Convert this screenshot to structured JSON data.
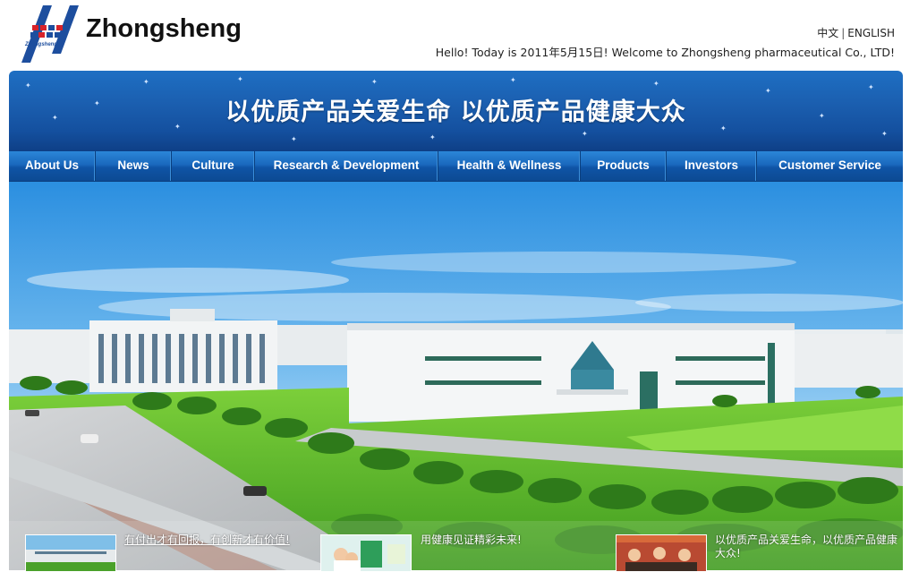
{
  "header": {
    "brand": "Zhongsheng",
    "logo_caption": "Zhongsheng",
    "lang_cn": "中文",
    "lang_sep": "|",
    "lang_en": "ENGLISH",
    "greeting": "Hello! Today is  2011年5月15日! Welcome to Zhongsheng pharmaceutical Co., LTD!"
  },
  "banner": {
    "slogan": "以优质产品关爱生命 以优质产品健康大众"
  },
  "nav": {
    "items": [
      "About Us",
      "News",
      "Culture",
      "Research & Development",
      "Health & Wellness",
      "Products",
      "Investors",
      "Customer Service"
    ]
  },
  "captions": [
    "有付出才有回报，有创新才有价值!",
    "用健康见证精彩未来!",
    "以优质产品关爱生命，以优质产品健康大众!"
  ],
  "colors": {
    "nav_blue": "#1a68bd",
    "banner_blue": "#1b5fb0",
    "logo_red": "#d8232a",
    "logo_blue": "#1d4e9e"
  },
  "icons": {
    "logo": "zhongsheng-logo-icon"
  }
}
